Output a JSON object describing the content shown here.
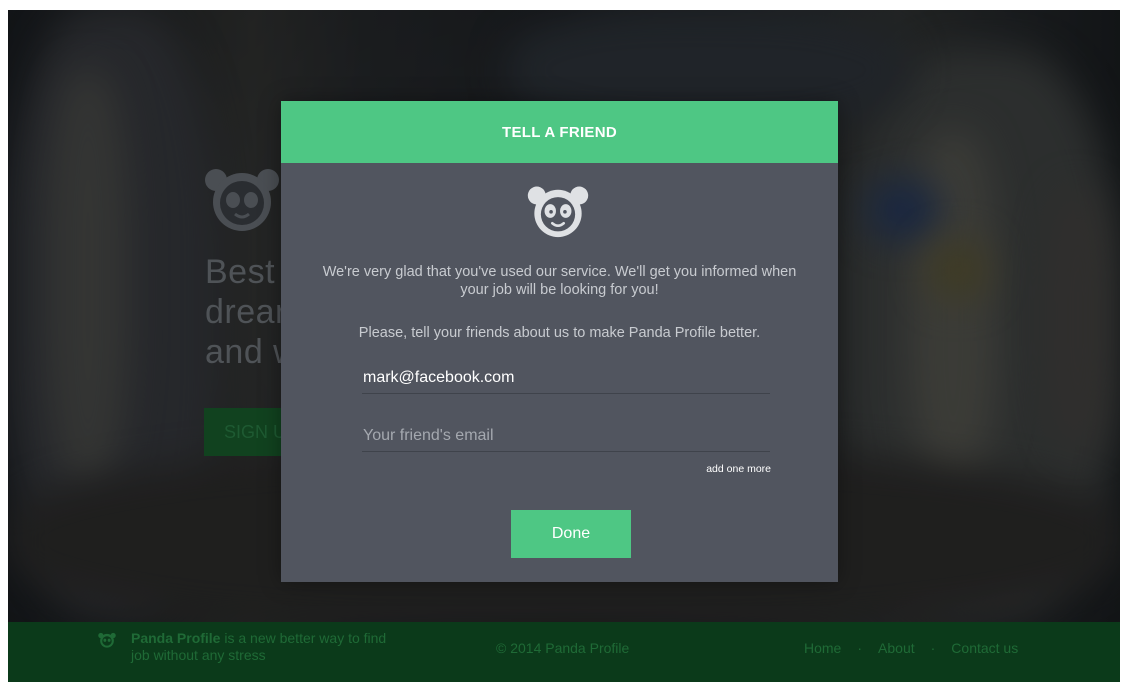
{
  "hero": {
    "line1": "Best",
    "line2": "drear",
    "line3": "and w",
    "signup_label": "SIGN U",
    "logo_icon": "panda-icon"
  },
  "modal": {
    "title": "TELL A FRIEND",
    "logo_icon": "panda-icon",
    "message": "We're very glad that you've used our service. We'll get you informed when your job will be looking for you!",
    "prompt": "Please, tell your friends about us to make Panda Profile better.",
    "email_value": "mark@facebook.com",
    "friend_email_placeholder": "Your friend's email",
    "add_more_label": "add one more",
    "done_label": "Done",
    "accent_color": "#4ec784"
  },
  "footer": {
    "brand": "Panda Profile",
    "tagline_rest": " is a new better way to find job without any stress",
    "copyright": "© 2014 Panda Profile",
    "nav": [
      "Home",
      "About",
      "Contact us"
    ],
    "separator": "·"
  }
}
